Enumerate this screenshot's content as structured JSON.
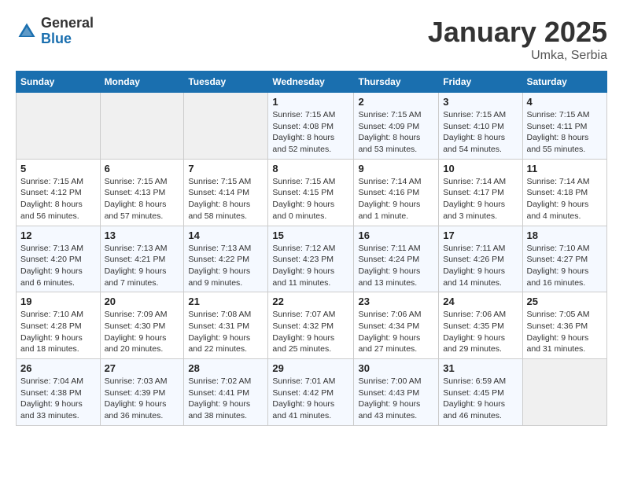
{
  "header": {
    "logo_general": "General",
    "logo_blue": "Blue",
    "title": "January 2025",
    "subtitle": "Umka, Serbia"
  },
  "weekdays": [
    "Sunday",
    "Monday",
    "Tuesday",
    "Wednesday",
    "Thursday",
    "Friday",
    "Saturday"
  ],
  "weeks": [
    [
      {
        "day": "",
        "info": ""
      },
      {
        "day": "",
        "info": ""
      },
      {
        "day": "",
        "info": ""
      },
      {
        "day": "1",
        "info": "Sunrise: 7:15 AM\nSunset: 4:08 PM\nDaylight: 8 hours\nand 52 minutes."
      },
      {
        "day": "2",
        "info": "Sunrise: 7:15 AM\nSunset: 4:09 PM\nDaylight: 8 hours\nand 53 minutes."
      },
      {
        "day": "3",
        "info": "Sunrise: 7:15 AM\nSunset: 4:10 PM\nDaylight: 8 hours\nand 54 minutes."
      },
      {
        "day": "4",
        "info": "Sunrise: 7:15 AM\nSunset: 4:11 PM\nDaylight: 8 hours\nand 55 minutes."
      }
    ],
    [
      {
        "day": "5",
        "info": "Sunrise: 7:15 AM\nSunset: 4:12 PM\nDaylight: 8 hours\nand 56 minutes."
      },
      {
        "day": "6",
        "info": "Sunrise: 7:15 AM\nSunset: 4:13 PM\nDaylight: 8 hours\nand 57 minutes."
      },
      {
        "day": "7",
        "info": "Sunrise: 7:15 AM\nSunset: 4:14 PM\nDaylight: 8 hours\nand 58 minutes."
      },
      {
        "day": "8",
        "info": "Sunrise: 7:15 AM\nSunset: 4:15 PM\nDaylight: 9 hours\nand 0 minutes."
      },
      {
        "day": "9",
        "info": "Sunrise: 7:14 AM\nSunset: 4:16 PM\nDaylight: 9 hours\nand 1 minute."
      },
      {
        "day": "10",
        "info": "Sunrise: 7:14 AM\nSunset: 4:17 PM\nDaylight: 9 hours\nand 3 minutes."
      },
      {
        "day": "11",
        "info": "Sunrise: 7:14 AM\nSunset: 4:18 PM\nDaylight: 9 hours\nand 4 minutes."
      }
    ],
    [
      {
        "day": "12",
        "info": "Sunrise: 7:13 AM\nSunset: 4:20 PM\nDaylight: 9 hours\nand 6 minutes."
      },
      {
        "day": "13",
        "info": "Sunrise: 7:13 AM\nSunset: 4:21 PM\nDaylight: 9 hours\nand 7 minutes."
      },
      {
        "day": "14",
        "info": "Sunrise: 7:13 AM\nSunset: 4:22 PM\nDaylight: 9 hours\nand 9 minutes."
      },
      {
        "day": "15",
        "info": "Sunrise: 7:12 AM\nSunset: 4:23 PM\nDaylight: 9 hours\nand 11 minutes."
      },
      {
        "day": "16",
        "info": "Sunrise: 7:11 AM\nSunset: 4:24 PM\nDaylight: 9 hours\nand 13 minutes."
      },
      {
        "day": "17",
        "info": "Sunrise: 7:11 AM\nSunset: 4:26 PM\nDaylight: 9 hours\nand 14 minutes."
      },
      {
        "day": "18",
        "info": "Sunrise: 7:10 AM\nSunset: 4:27 PM\nDaylight: 9 hours\nand 16 minutes."
      }
    ],
    [
      {
        "day": "19",
        "info": "Sunrise: 7:10 AM\nSunset: 4:28 PM\nDaylight: 9 hours\nand 18 minutes."
      },
      {
        "day": "20",
        "info": "Sunrise: 7:09 AM\nSunset: 4:30 PM\nDaylight: 9 hours\nand 20 minutes."
      },
      {
        "day": "21",
        "info": "Sunrise: 7:08 AM\nSunset: 4:31 PM\nDaylight: 9 hours\nand 22 minutes."
      },
      {
        "day": "22",
        "info": "Sunrise: 7:07 AM\nSunset: 4:32 PM\nDaylight: 9 hours\nand 25 minutes."
      },
      {
        "day": "23",
        "info": "Sunrise: 7:06 AM\nSunset: 4:34 PM\nDaylight: 9 hours\nand 27 minutes."
      },
      {
        "day": "24",
        "info": "Sunrise: 7:06 AM\nSunset: 4:35 PM\nDaylight: 9 hours\nand 29 minutes."
      },
      {
        "day": "25",
        "info": "Sunrise: 7:05 AM\nSunset: 4:36 PM\nDaylight: 9 hours\nand 31 minutes."
      }
    ],
    [
      {
        "day": "26",
        "info": "Sunrise: 7:04 AM\nSunset: 4:38 PM\nDaylight: 9 hours\nand 33 minutes."
      },
      {
        "day": "27",
        "info": "Sunrise: 7:03 AM\nSunset: 4:39 PM\nDaylight: 9 hours\nand 36 minutes."
      },
      {
        "day": "28",
        "info": "Sunrise: 7:02 AM\nSunset: 4:41 PM\nDaylight: 9 hours\nand 38 minutes."
      },
      {
        "day": "29",
        "info": "Sunrise: 7:01 AM\nSunset: 4:42 PM\nDaylight: 9 hours\nand 41 minutes."
      },
      {
        "day": "30",
        "info": "Sunrise: 7:00 AM\nSunset: 4:43 PM\nDaylight: 9 hours\nand 43 minutes."
      },
      {
        "day": "31",
        "info": "Sunrise: 6:59 AM\nSunset: 4:45 PM\nDaylight: 9 hours\nand 46 minutes."
      },
      {
        "day": "",
        "info": ""
      }
    ]
  ]
}
